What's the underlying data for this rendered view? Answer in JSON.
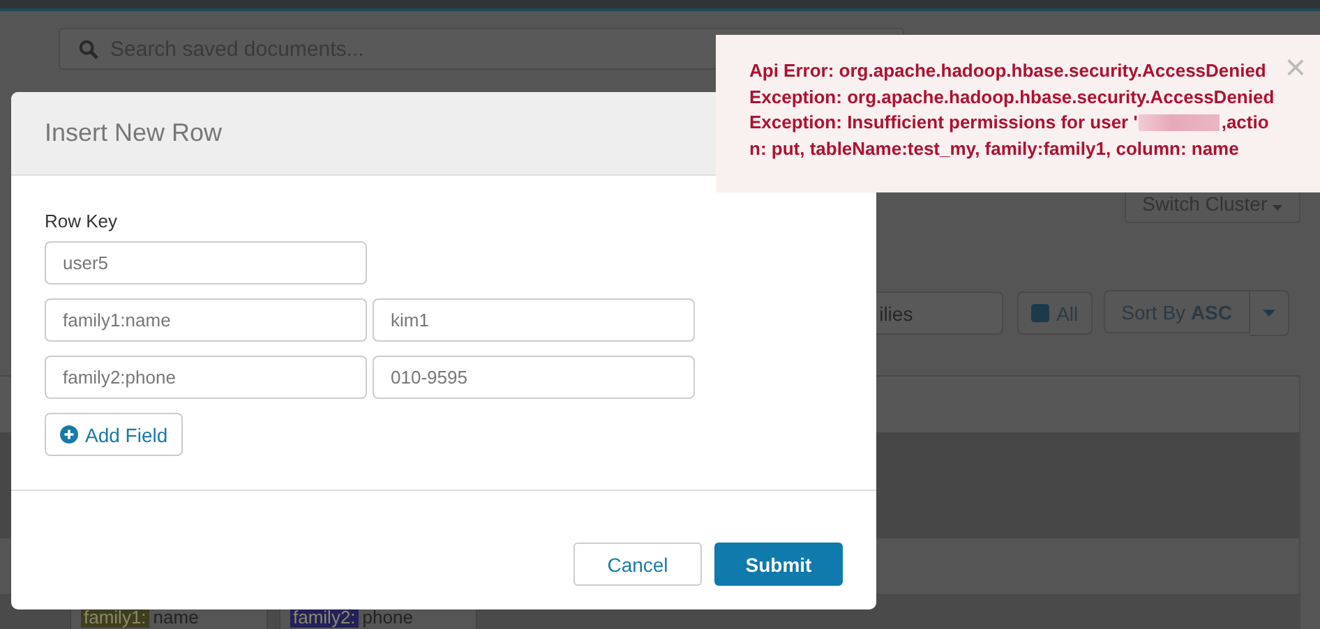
{
  "background_page": {
    "search": {
      "placeholder": "Search saved documents..."
    },
    "switch_cluster": {
      "label": "Switch Cluster"
    },
    "filter": {
      "placeholder": "ilies"
    },
    "all_toggle": {
      "label": "All",
      "checked": true
    },
    "sort": {
      "prefix": "Sort By",
      "order": "ASC"
    },
    "table_cells": [
      {
        "family": "family1:",
        "column": "name",
        "color": "#3f3f1f"
      },
      {
        "family": "family2:",
        "column": "phone",
        "color": "#23205a"
      }
    ]
  },
  "modal": {
    "title": "Insert New Row",
    "row_key_label": "Row Key",
    "row_key": "user5",
    "fields": [
      {
        "column": "family1:name",
        "value": "kim1"
      },
      {
        "column": "family2:phone",
        "value": "010-9595"
      }
    ],
    "add_field": "Add Field",
    "buttons": [
      {
        "label": "Cancel",
        "kind": "secondary"
      },
      {
        "label": "Submit",
        "kind": "primary"
      }
    ]
  },
  "toast": {
    "lines": [
      {
        "text": "Api Error: org.apache.hadoop.hbase.security.AccessDenied",
        "redacted": false
      },
      {
        "text": "Exception: org.apache.hadoop.hbase.security.AccessDenied",
        "redacted": false
      },
      {
        "text": "Exception: Insufficient permissions for user '",
        "redacted": true,
        "rest": ",actio"
      },
      {
        "text": "n: put, tableName:test_my, family:family1, column: name",
        "redacted": false
      }
    ],
    "close": "×"
  }
}
